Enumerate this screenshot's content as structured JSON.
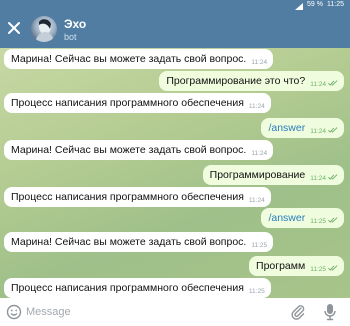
{
  "status_bar": {
    "battery": "59 %",
    "time": "11:25"
  },
  "header": {
    "title": "Эхо",
    "subtitle": "bot"
  },
  "messages": [
    {
      "text": "Марина! Сейчас вы можете задать свой вопрос.",
      "time": "11:24",
      "direction": "in"
    },
    {
      "text": "Программирование это что?",
      "time": "11:24",
      "direction": "out"
    },
    {
      "text": "Процесс написания программного обеспечения",
      "time": "11:24",
      "direction": "in"
    },
    {
      "text": "/answer",
      "time": "11:24",
      "direction": "out"
    },
    {
      "text": "Марина! Сейчас вы можете задать свой вопрос.",
      "time": "11:24",
      "direction": "in"
    },
    {
      "text": "Программирование",
      "time": "11:24",
      "direction": "out"
    },
    {
      "text": "Процесс написания программного обеспечения",
      "time": "11:24",
      "direction": "in"
    },
    {
      "text": "/answer",
      "time": "11:25",
      "direction": "out"
    },
    {
      "text": "Марина! Сейчас вы можете задать свой вопрос.",
      "time": "11:25",
      "direction": "in"
    },
    {
      "text": "Программ",
      "time": "11:25",
      "direction": "out"
    },
    {
      "text": "Процесс написания программного обеспечения",
      "time": "11:25",
      "direction": "in"
    }
  ],
  "composer": {
    "placeholder": "Message"
  },
  "icons": {
    "back": "close-icon",
    "emoji": "emoji-icon",
    "attach": "paperclip-icon",
    "mic": "microphone-icon",
    "read": "double-check-icon"
  },
  "colors": {
    "header": "#517da2",
    "incoming_bubble": "#ffffff",
    "outgoing_bubble": "#effdde",
    "link": "#2a7bbd",
    "read_ticks": "#6fb06a"
  }
}
